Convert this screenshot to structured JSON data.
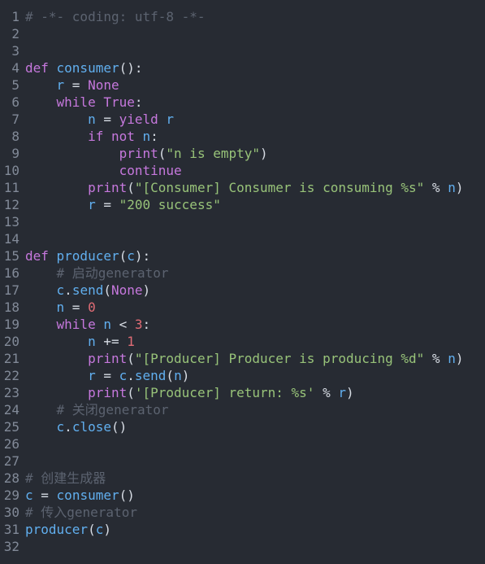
{
  "editor": {
    "language": "python",
    "colors": {
      "background": "#272b33",
      "gutter": "#828a98",
      "keyword": "#c678dd",
      "function": "#61afef",
      "variable": "#61afef",
      "string": "#98c379",
      "number": "#e06c75",
      "comment": "#5c6370",
      "plain": "#d7dce4"
    },
    "lines": [
      {
        "n": "1",
        "tokens": [
          {
            "t": "# -*- coding: utf-8 -*-",
            "c": "cmt"
          }
        ]
      },
      {
        "n": "2",
        "tokens": []
      },
      {
        "n": "3",
        "tokens": []
      },
      {
        "n": "4",
        "tokens": [
          {
            "t": "def ",
            "c": "kw"
          },
          {
            "t": "consumer",
            "c": "fn"
          },
          {
            "t": "():",
            "c": "punc"
          }
        ]
      },
      {
        "n": "5",
        "tokens": [
          {
            "t": "    ",
            "c": "plain"
          },
          {
            "t": "r",
            "c": "var"
          },
          {
            "t": " = ",
            "c": "op"
          },
          {
            "t": "None",
            "c": "const"
          }
        ]
      },
      {
        "n": "6",
        "tokens": [
          {
            "t": "    ",
            "c": "plain"
          },
          {
            "t": "while ",
            "c": "kw"
          },
          {
            "t": "True",
            "c": "const"
          },
          {
            "t": ":",
            "c": "punc"
          }
        ]
      },
      {
        "n": "7",
        "tokens": [
          {
            "t": "        ",
            "c": "plain"
          },
          {
            "t": "n",
            "c": "var"
          },
          {
            "t": " = ",
            "c": "op"
          },
          {
            "t": "yield ",
            "c": "kw"
          },
          {
            "t": "r",
            "c": "var"
          }
        ]
      },
      {
        "n": "8",
        "tokens": [
          {
            "t": "        ",
            "c": "plain"
          },
          {
            "t": "if ",
            "c": "kw"
          },
          {
            "t": "not ",
            "c": "kw"
          },
          {
            "t": "n",
            "c": "var"
          },
          {
            "t": ":",
            "c": "punc"
          }
        ]
      },
      {
        "n": "9",
        "tokens": [
          {
            "t": "            ",
            "c": "plain"
          },
          {
            "t": "print",
            "c": "kw"
          },
          {
            "t": "(",
            "c": "punc"
          },
          {
            "t": "\"n is empty\"",
            "c": "str"
          },
          {
            "t": ")",
            "c": "punc"
          }
        ]
      },
      {
        "n": "10",
        "tokens": [
          {
            "t": "            ",
            "c": "plain"
          },
          {
            "t": "continue",
            "c": "kw"
          }
        ]
      },
      {
        "n": "11",
        "tokens": [
          {
            "t": "        ",
            "c": "plain"
          },
          {
            "t": "print",
            "c": "kw"
          },
          {
            "t": "(",
            "c": "punc"
          },
          {
            "t": "\"[Consumer] Consumer is consuming %s\"",
            "c": "str"
          },
          {
            "t": " % ",
            "c": "op"
          },
          {
            "t": "n",
            "c": "var"
          },
          {
            "t": ")",
            "c": "punc"
          }
        ]
      },
      {
        "n": "12",
        "tokens": [
          {
            "t": "        ",
            "c": "plain"
          },
          {
            "t": "r",
            "c": "var"
          },
          {
            "t": " = ",
            "c": "op"
          },
          {
            "t": "\"200 success\"",
            "c": "str"
          }
        ]
      },
      {
        "n": "13",
        "tokens": []
      },
      {
        "n": "14",
        "tokens": []
      },
      {
        "n": "15",
        "tokens": [
          {
            "t": "def ",
            "c": "kw"
          },
          {
            "t": "producer",
            "c": "fn"
          },
          {
            "t": "(",
            "c": "punc"
          },
          {
            "t": "c",
            "c": "var"
          },
          {
            "t": "):",
            "c": "punc"
          }
        ]
      },
      {
        "n": "16",
        "tokens": [
          {
            "t": "    ",
            "c": "plain"
          },
          {
            "t": "# 启动generator",
            "c": "cmt"
          }
        ]
      },
      {
        "n": "17",
        "tokens": [
          {
            "t": "    ",
            "c": "plain"
          },
          {
            "t": "c",
            "c": "var"
          },
          {
            "t": ".",
            "c": "punc"
          },
          {
            "t": "send",
            "c": "fn"
          },
          {
            "t": "(",
            "c": "punc"
          },
          {
            "t": "None",
            "c": "const"
          },
          {
            "t": ")",
            "c": "punc"
          }
        ]
      },
      {
        "n": "18",
        "tokens": [
          {
            "t": "    ",
            "c": "plain"
          },
          {
            "t": "n",
            "c": "var"
          },
          {
            "t": " = ",
            "c": "op"
          },
          {
            "t": "0",
            "c": "num"
          }
        ]
      },
      {
        "n": "19",
        "tokens": [
          {
            "t": "    ",
            "c": "plain"
          },
          {
            "t": "while ",
            "c": "kw"
          },
          {
            "t": "n",
            "c": "var"
          },
          {
            "t": " < ",
            "c": "op"
          },
          {
            "t": "3",
            "c": "num"
          },
          {
            "t": ":",
            "c": "punc"
          }
        ]
      },
      {
        "n": "20",
        "tokens": [
          {
            "t": "        ",
            "c": "plain"
          },
          {
            "t": "n",
            "c": "var"
          },
          {
            "t": " += ",
            "c": "op"
          },
          {
            "t": "1",
            "c": "num"
          }
        ]
      },
      {
        "n": "21",
        "tokens": [
          {
            "t": "        ",
            "c": "plain"
          },
          {
            "t": "print",
            "c": "kw"
          },
          {
            "t": "(",
            "c": "punc"
          },
          {
            "t": "\"[Producer] Producer is producing %d\"",
            "c": "str"
          },
          {
            "t": " % ",
            "c": "op"
          },
          {
            "t": "n",
            "c": "var"
          },
          {
            "t": ")",
            "c": "punc"
          }
        ]
      },
      {
        "n": "22",
        "tokens": [
          {
            "t": "        ",
            "c": "plain"
          },
          {
            "t": "r",
            "c": "var"
          },
          {
            "t": " = ",
            "c": "op"
          },
          {
            "t": "c",
            "c": "var"
          },
          {
            "t": ".",
            "c": "punc"
          },
          {
            "t": "send",
            "c": "fn"
          },
          {
            "t": "(",
            "c": "punc"
          },
          {
            "t": "n",
            "c": "var"
          },
          {
            "t": ")",
            "c": "punc"
          }
        ]
      },
      {
        "n": "23",
        "tokens": [
          {
            "t": "        ",
            "c": "plain"
          },
          {
            "t": "print",
            "c": "kw"
          },
          {
            "t": "(",
            "c": "punc"
          },
          {
            "t": "'[Producer] return: %s'",
            "c": "str"
          },
          {
            "t": " % ",
            "c": "op"
          },
          {
            "t": "r",
            "c": "var"
          },
          {
            "t": ")",
            "c": "punc"
          }
        ]
      },
      {
        "n": "24",
        "tokens": [
          {
            "t": "    ",
            "c": "plain"
          },
          {
            "t": "# 关闭generator",
            "c": "cmt"
          }
        ]
      },
      {
        "n": "25",
        "tokens": [
          {
            "t": "    ",
            "c": "plain"
          },
          {
            "t": "c",
            "c": "var"
          },
          {
            "t": ".",
            "c": "punc"
          },
          {
            "t": "close",
            "c": "fn"
          },
          {
            "t": "()",
            "c": "punc"
          }
        ]
      },
      {
        "n": "26",
        "tokens": []
      },
      {
        "n": "27",
        "tokens": []
      },
      {
        "n": "28",
        "tokens": [
          {
            "t": "# 创建生成器",
            "c": "cmt"
          }
        ]
      },
      {
        "n": "29",
        "tokens": [
          {
            "t": "c",
            "c": "var"
          },
          {
            "t": " = ",
            "c": "op"
          },
          {
            "t": "consumer",
            "c": "fn"
          },
          {
            "t": "()",
            "c": "punc"
          }
        ]
      },
      {
        "n": "30",
        "tokens": [
          {
            "t": "# 传入generator",
            "c": "cmt"
          }
        ]
      },
      {
        "n": "31",
        "tokens": [
          {
            "t": "producer",
            "c": "fn"
          },
          {
            "t": "(",
            "c": "punc"
          },
          {
            "t": "c",
            "c": "var"
          },
          {
            "t": ")",
            "c": "punc"
          }
        ]
      },
      {
        "n": "32",
        "tokens": []
      }
    ]
  }
}
